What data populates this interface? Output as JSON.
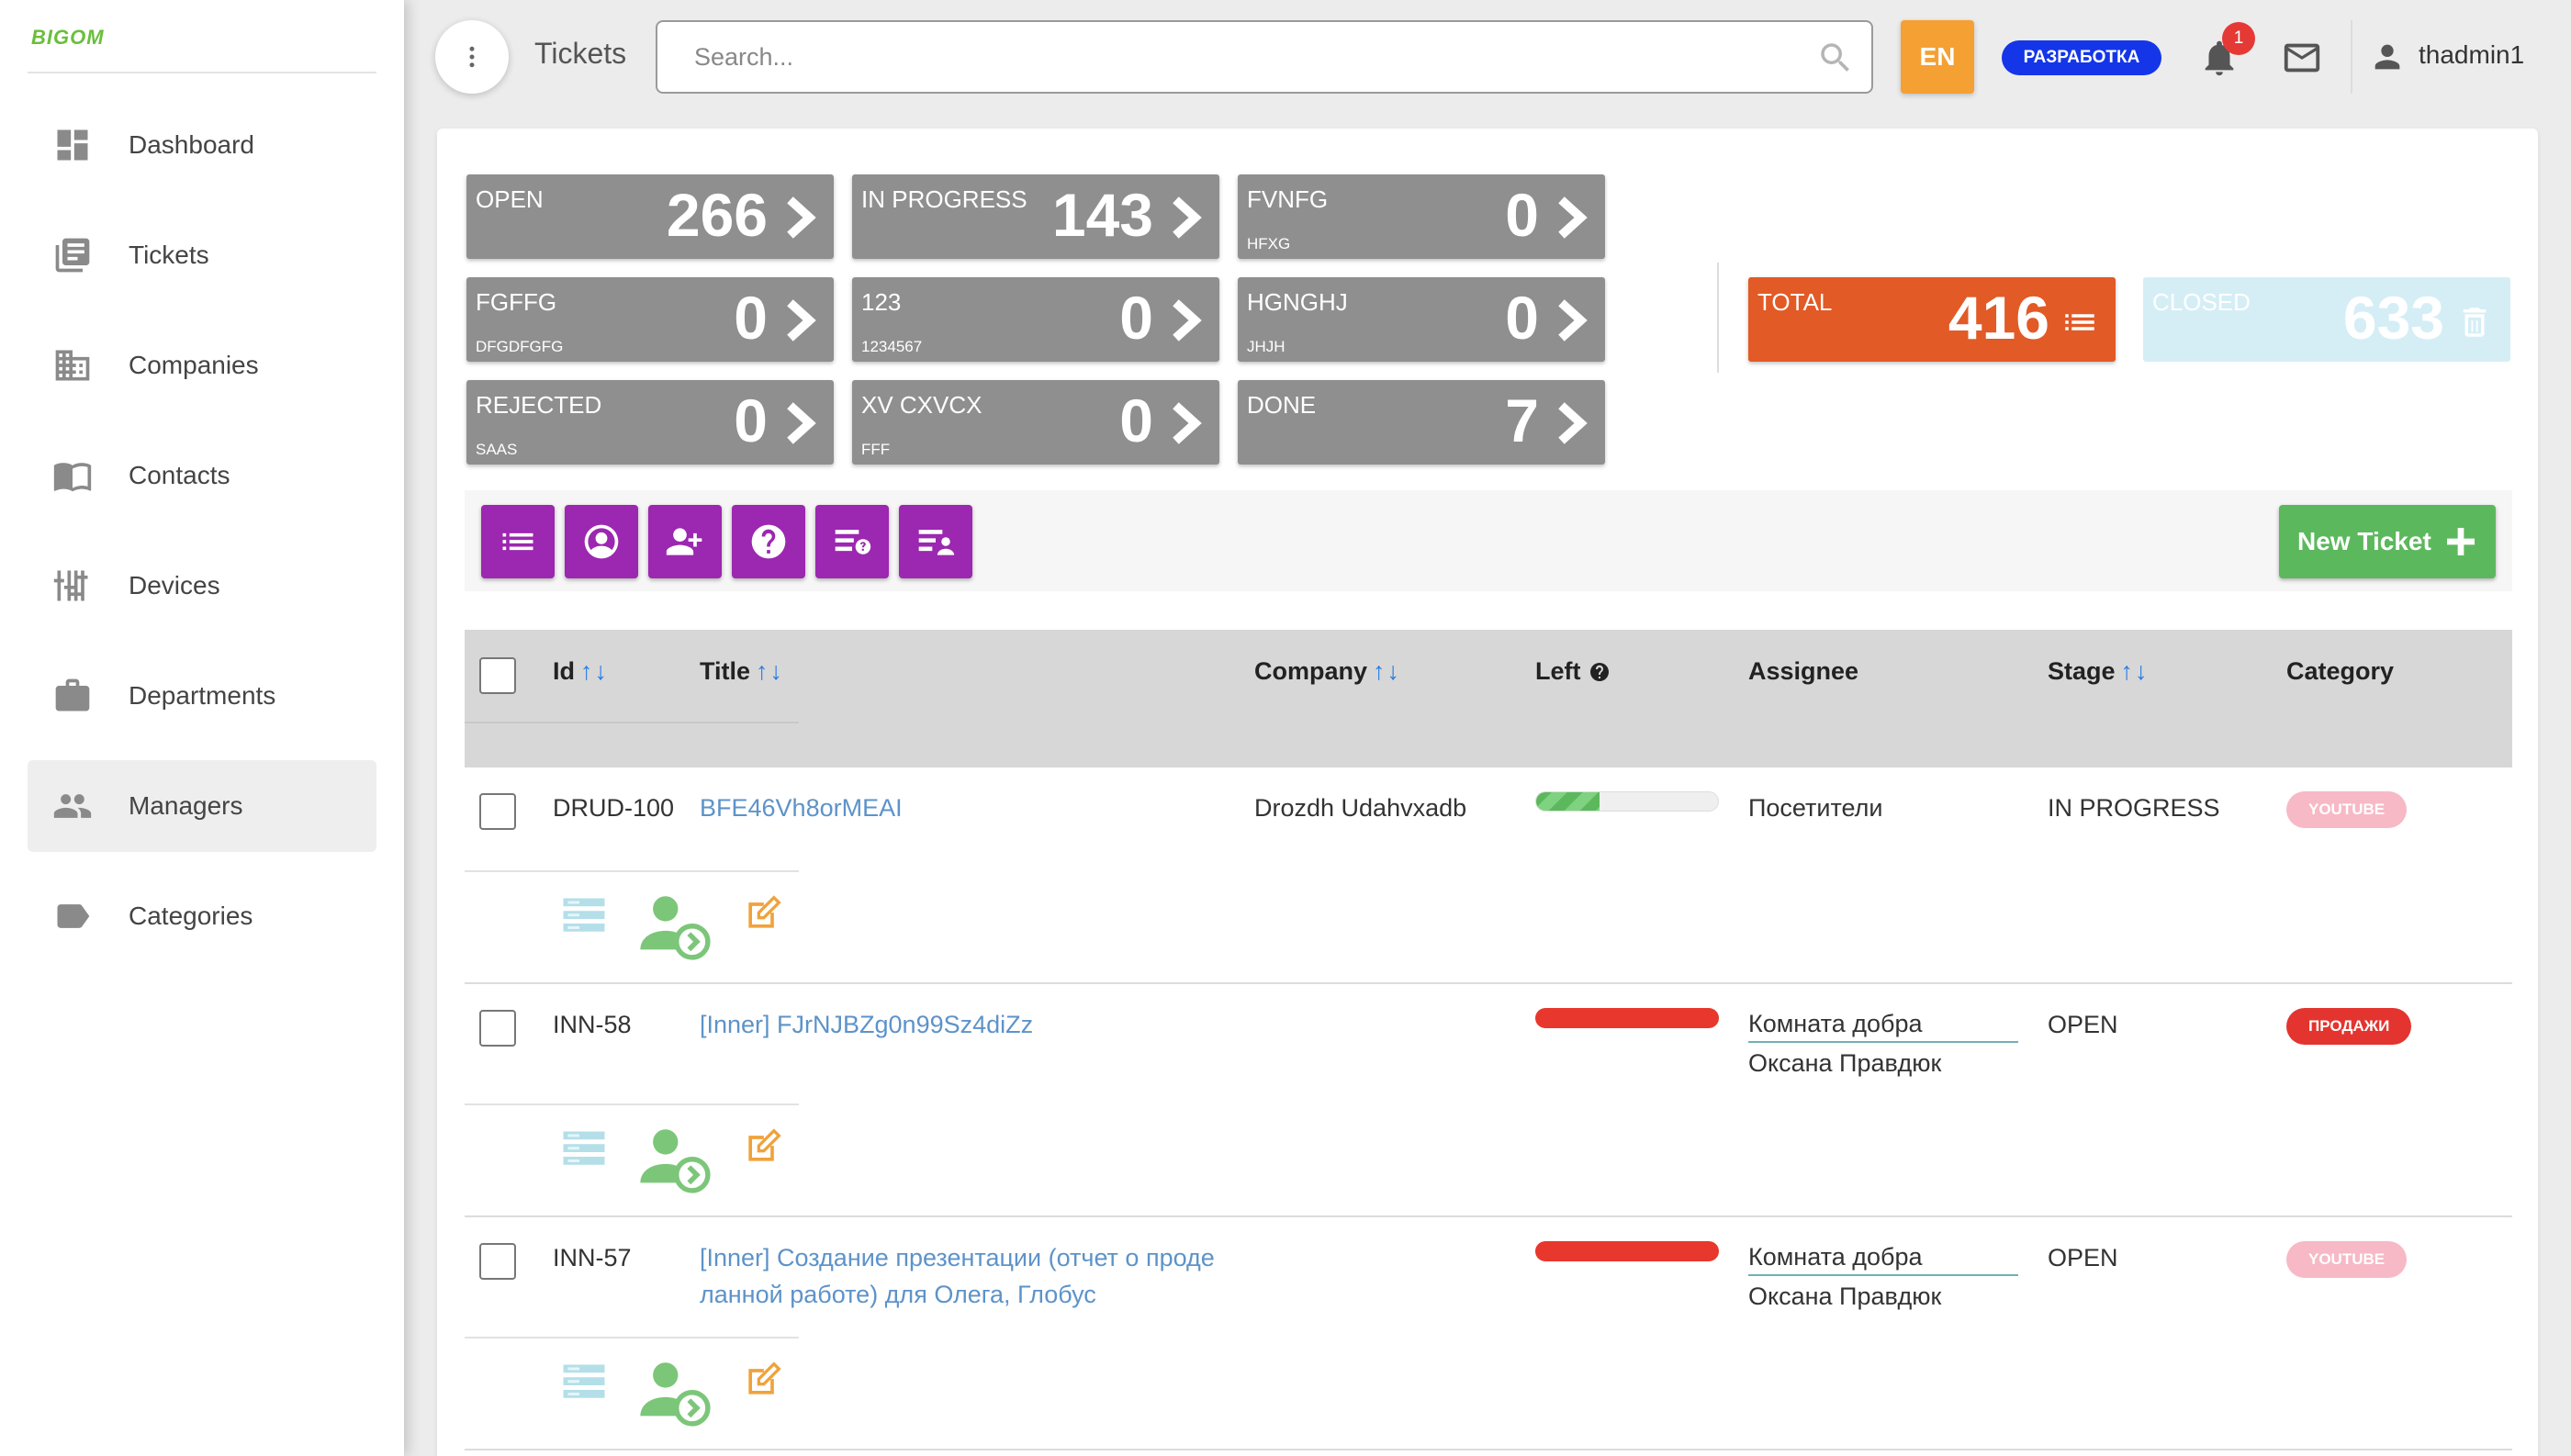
{
  "logo": "BIGOM",
  "sidebar": {
    "items": [
      {
        "label": "Dashboard"
      },
      {
        "label": "Tickets"
      },
      {
        "label": "Companies"
      },
      {
        "label": "Contacts"
      },
      {
        "label": "Devices"
      },
      {
        "label": "Departments"
      },
      {
        "label": "Managers"
      },
      {
        "label": "Categories"
      }
    ]
  },
  "header": {
    "title": "Tickets",
    "search_placeholder": "Search...",
    "lang": "EN",
    "env": "РАЗРАБОТКА",
    "notifications": "1",
    "user": "thadmin1"
  },
  "stats": [
    {
      "label": "OPEN",
      "sub": "",
      "value": "266"
    },
    {
      "label": "IN PROGRESS",
      "sub": "",
      "value": "143"
    },
    {
      "label": "FVNFG",
      "sub": "HFXG",
      "value": "0"
    },
    {
      "label": "FGFFG",
      "sub": "DFGDFGFG",
      "value": "0"
    },
    {
      "label": "123",
      "sub": "1234567",
      "value": "0"
    },
    {
      "label": "HGNGHJ",
      "sub": "JHJH",
      "value": "0"
    },
    {
      "label": "REJECTED",
      "sub": "SAAS",
      "value": "0"
    },
    {
      "label": "XV CXVCX",
      "sub": "FFF",
      "value": "0"
    },
    {
      "label": "DONE",
      "sub": "",
      "value": "7"
    }
  ],
  "total": {
    "label": "TOTAL",
    "value": "416"
  },
  "closed": {
    "label": "CLOSED",
    "value": "633"
  },
  "new_ticket": "New Ticket",
  "table": {
    "columns": {
      "id": "Id",
      "title": "Title",
      "company": "Company",
      "left": "Left",
      "assignee": "Assignee",
      "stage": "Stage",
      "category": "Category"
    },
    "sort_arrows": "↑↓",
    "rows": [
      {
        "id": "DRUD-100",
        "title": "BFE46Vh8orMEAI",
        "company": "Drozdh Udahvxadb",
        "progress": 0.35,
        "assignee_team": "Посетители",
        "assignee_person": "",
        "stage": "IN PROGRESS",
        "category": "YOUTUBE"
      },
      {
        "id": "INN-58",
        "title": "[Inner] FJrNJBZg0n99Sz4diZz",
        "company": "",
        "progress": 1,
        "assignee_team": "Комната добра",
        "assignee_person": "Оксана Правдюк",
        "stage": "OPEN",
        "category": "ПРОДАЖИ"
      },
      {
        "id": "INN-57",
        "title_line1": "[Inner] Создание презентации (отчет о проде",
        "title_line2": "ланной работе) для Олега, Глобус",
        "company": "",
        "progress": 1,
        "assignee_team": "Комната добра",
        "assignee_person": "Оксана Правдюк",
        "stage": "OPEN",
        "category": "YOUTUBE"
      }
    ]
  },
  "colors": {
    "accent_purple": "#9c27b0",
    "total_orange": "#e25a26",
    "new_ticket_green": "#5cb85c",
    "link_blue": "#5d93c9",
    "env_blue": "#1436e8"
  }
}
